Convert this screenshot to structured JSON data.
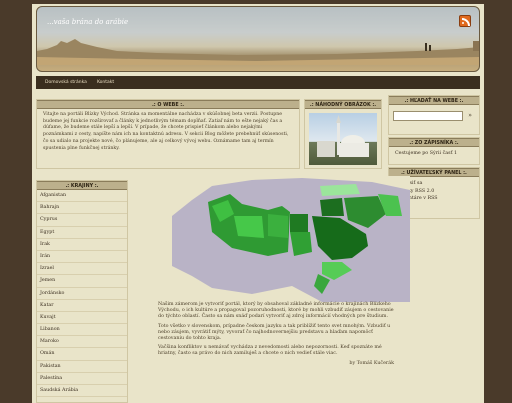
{
  "header": {
    "title": "...vaša brána do arábie",
    "rss_icon": "rss-icon"
  },
  "nav": {
    "items": [
      "Domovská stránka",
      "Kontakt"
    ]
  },
  "o_webe": {
    "title": ".: O WEBE :.",
    "text": "Vitajte na portáli Blízky Východ. Stránka sa momentálne nachádza v skúšobnej beta verzii. Postupne budeme jej funkcie rozširovať a články k jednotlivým témam dopĺňať. Zatiaľ nám to ešte nejaký čas a dúfame, že budeme stále lepší a lepší. V prípade, že chcete prispieť článkom alebo nejakými poznámkami z cesty, napíšte nám ich na kontaktnú adresu. V sekcii Blog môžete prebehnúť skúsenosti, čo sa udialo na projekte nové, čo plánujeme, ale aj celkový vývoj webu. Oznámame tam aj termín spustenia plne funkčnej stránky."
  },
  "nahodny": {
    "title": ".: NÁHODNÝ OBRÁZOK :."
  },
  "hladat": {
    "title": ".: HĽADAŤ NA WEBE :.",
    "placeholder": "",
    "go": "»"
  },
  "zapisnik": {
    "title": ".: ZO ZÁPISNÍKA :.",
    "item": "Cestujeme po Sýrii časť 1"
  },
  "uziv": {
    "title": ".: UŽÍVATEĽSKÝ PANEL :.",
    "items": [
      "Prihlásiť sa",
      "Položky RSS 2.0",
      "Komentáre v RSS",
      "Wp.sk"
    ]
  },
  "krajiny": {
    "title": ".: KRAJINY :.",
    "items": [
      "Afganistan",
      "Bahrajn",
      "Cyprus",
      "Egypt",
      "Irak",
      "Irán",
      "Izrael",
      "Jemen",
      "Jordánsko",
      "Katar",
      "Kuvajt",
      "Libanon",
      "Maroko",
      "Omán",
      "Pakistan",
      "Palestína",
      "Saudská Arábia"
    ]
  },
  "article": {
    "p1": "Našim zámerom je vytvoriť portál, ktorý by obsahoval základné informácie o krajinách Blízkeho Východu, o ich kultúre a propagoval pozoruhodnosti, ktoré by mohli vzbudiť záujem o cestovanie do týchto oblastí. Často sa nám snáď podarí vytvoriť aj zdroj informácií vhodných pre študium.",
    "p2": "Toto všetko v slovenskom, prípadne českom jazyku a tak priblížiť tento svet mnohým. Vzbudiť u nebo záujem, vyvrátiť mýty, vyvorať čo najhodnovernejšiu predstavu a hlaďam napomôcť cestovaniu do tohto kraja.",
    "p3": "Vačšina konfliktov u nemávať vychádza z nevedomosti alebo nepozornosti. Keď spoznáte mé hriatny, často sa právo do nich zamiluješ a chcete o nich vedieť stále viac.",
    "sig": "by Tomáš Kučerák"
  }
}
